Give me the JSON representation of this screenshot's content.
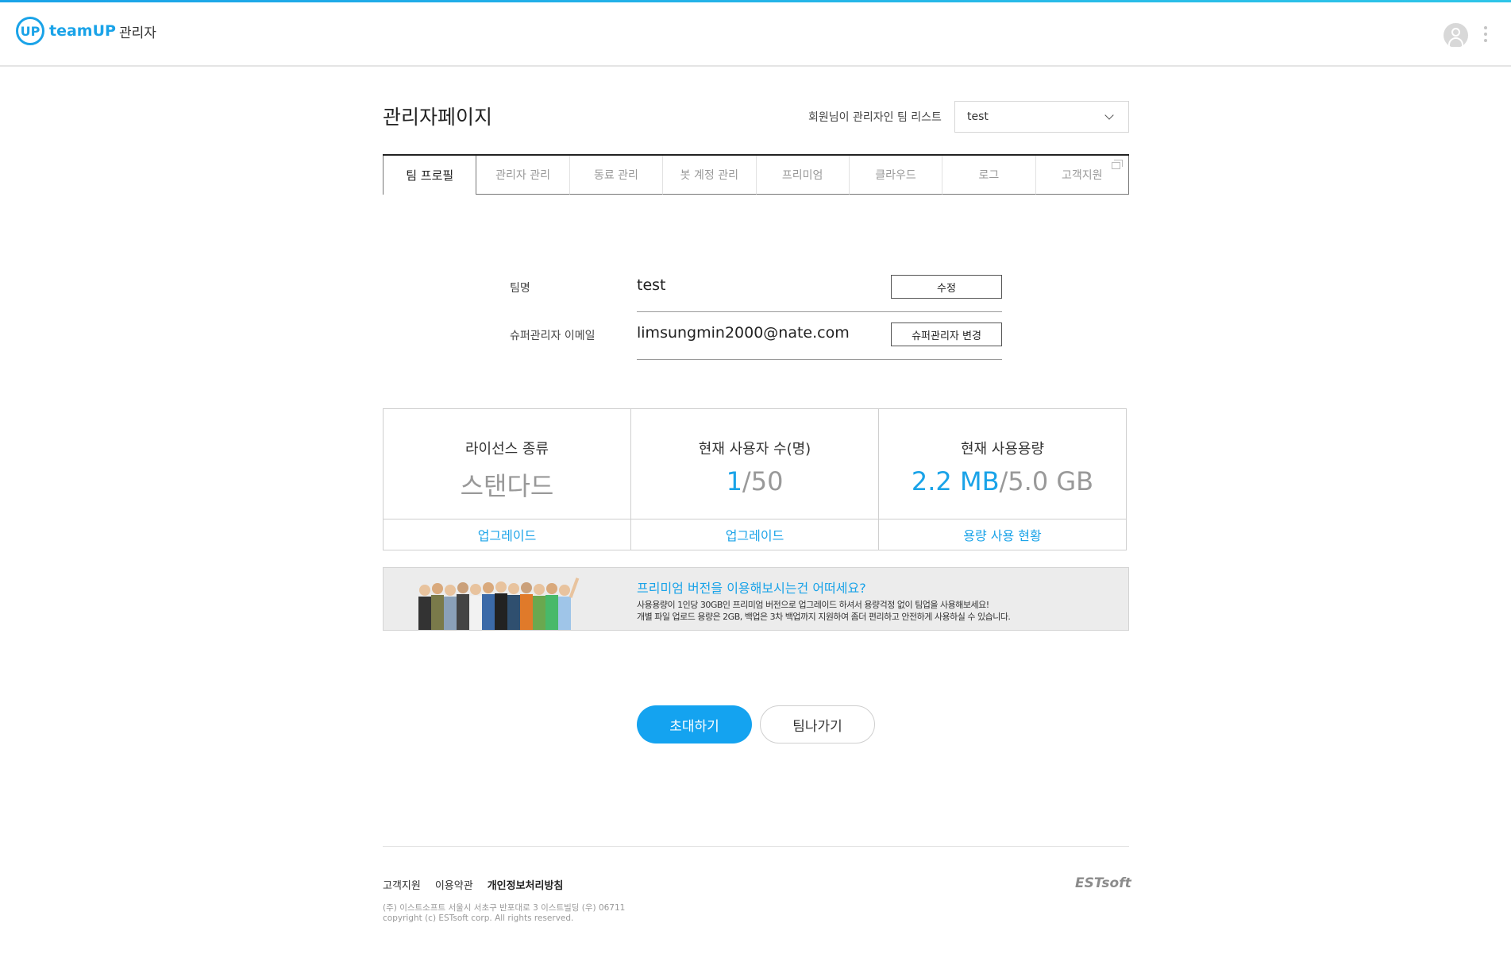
{
  "header": {
    "logo_mark": "UP",
    "logo_name": "teamUP",
    "logo_sub": "관리자"
  },
  "page": {
    "title": "관리자페이지",
    "team_select_label": "회원님이 관리자인 팀 리스트",
    "team_select_value": "test"
  },
  "tabs": [
    {
      "label": "팀 프로필"
    },
    {
      "label": "관리자 관리"
    },
    {
      "label": "동료 관리"
    },
    {
      "label": "봇 계정 관리"
    },
    {
      "label": "프리미엄"
    },
    {
      "label": "클라우드"
    },
    {
      "label": "로그"
    },
    {
      "label": "고객지원"
    }
  ],
  "profile": {
    "team_name_label": "팀명",
    "team_name_value": "test",
    "edit_button": "수정",
    "super_admin_label": "슈퍼관리자 이메일",
    "super_admin_value": "limsungmin2000@nate.com",
    "change_super_admin_button": "슈퍼관리자 변경"
  },
  "stats": {
    "license": {
      "label": "라이선스 종류",
      "value": "스탠다드",
      "link": "업그레이드"
    },
    "users": {
      "label": "현재 사용자 수(명)",
      "current": "1",
      "max": "/50",
      "link": "업그레이드"
    },
    "storage": {
      "label": "현재 사용용량",
      "used": "2.2 MB",
      "total": "/5.0 GB",
      "link": "용량 사용 현황"
    }
  },
  "promo": {
    "title": "프리미엄 버전을 이용해보시는건 어떠세요?",
    "line1": "사용용량이 1인당 30GB인 프리미엄 버전으로 업그레이드 하셔서 용량걱정 없이 팀업을 사용해보세요!",
    "line2": "개별 파일 업로드 용량은 2GB, 백업은 3차 백업까지 지원하여 좀더 편리하고 안전하게 사용하실 수 있습니다."
  },
  "actions": {
    "invite": "초대하기",
    "leave": "팀나가기"
  },
  "footer": {
    "support": "고객지원",
    "terms": "이용약관",
    "privacy": "개인정보처리방침",
    "company_logo": "ESTsoft",
    "address": "(주) 이스트소프트 서울시 서초구 반포대로 3 이스트빌딩 (우) 06711",
    "copyright": "copyright (c) ESTsoft corp. All rights reserved."
  },
  "colors": {
    "accent": "#14a3f0",
    "promo_bg": "#ececec"
  }
}
